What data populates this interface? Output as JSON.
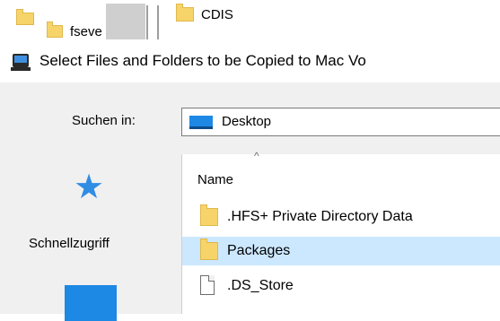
{
  "background_window": {
    "items": [
      {
        "label": "fseve"
      },
      {
        "label": "CDIS"
      }
    ]
  },
  "dialog": {
    "title": "Select Files and Folders to be Copied to Mac Vo",
    "look_in": {
      "label": "Suchen in:",
      "value": "Desktop"
    },
    "places": [
      {
        "label": "Schnellzugriff",
        "icon": "star-icon"
      },
      {
        "label": "",
        "icon": "desktop-icon"
      }
    ],
    "file_list": {
      "column_header": "Name",
      "rows": [
        {
          "name": ".HFS+ Private Directory Data",
          "type": "folder",
          "selected": false
        },
        {
          "name": "Packages",
          "type": "folder",
          "selected": true
        },
        {
          "name": ".DS_Store",
          "type": "file",
          "selected": false
        }
      ]
    }
  },
  "colors": {
    "accent": "#1e88e5",
    "selection": "#cce8ff",
    "folder": "#f7d46a"
  }
}
